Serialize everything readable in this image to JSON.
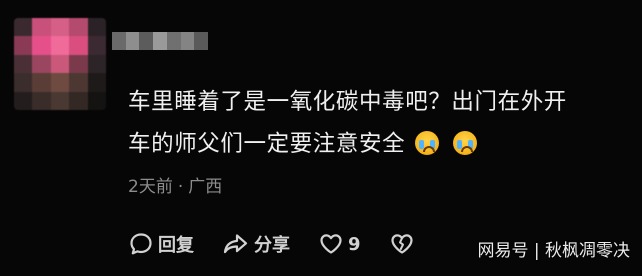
{
  "comment": {
    "text_line_1": "车里睡着了是一氧化碳中毒吧？出门在外开",
    "text_line_2": "车的师父们一定要注意安全",
    "emoji": [
      "crying-face",
      "crying-face"
    ],
    "time": "2天前",
    "separator": "·",
    "location": "广西"
  },
  "actions": {
    "reply_label": "回复",
    "share_label": "分享",
    "like_count": "9"
  },
  "watermark": "网易号 | 秋枫凋零决"
}
